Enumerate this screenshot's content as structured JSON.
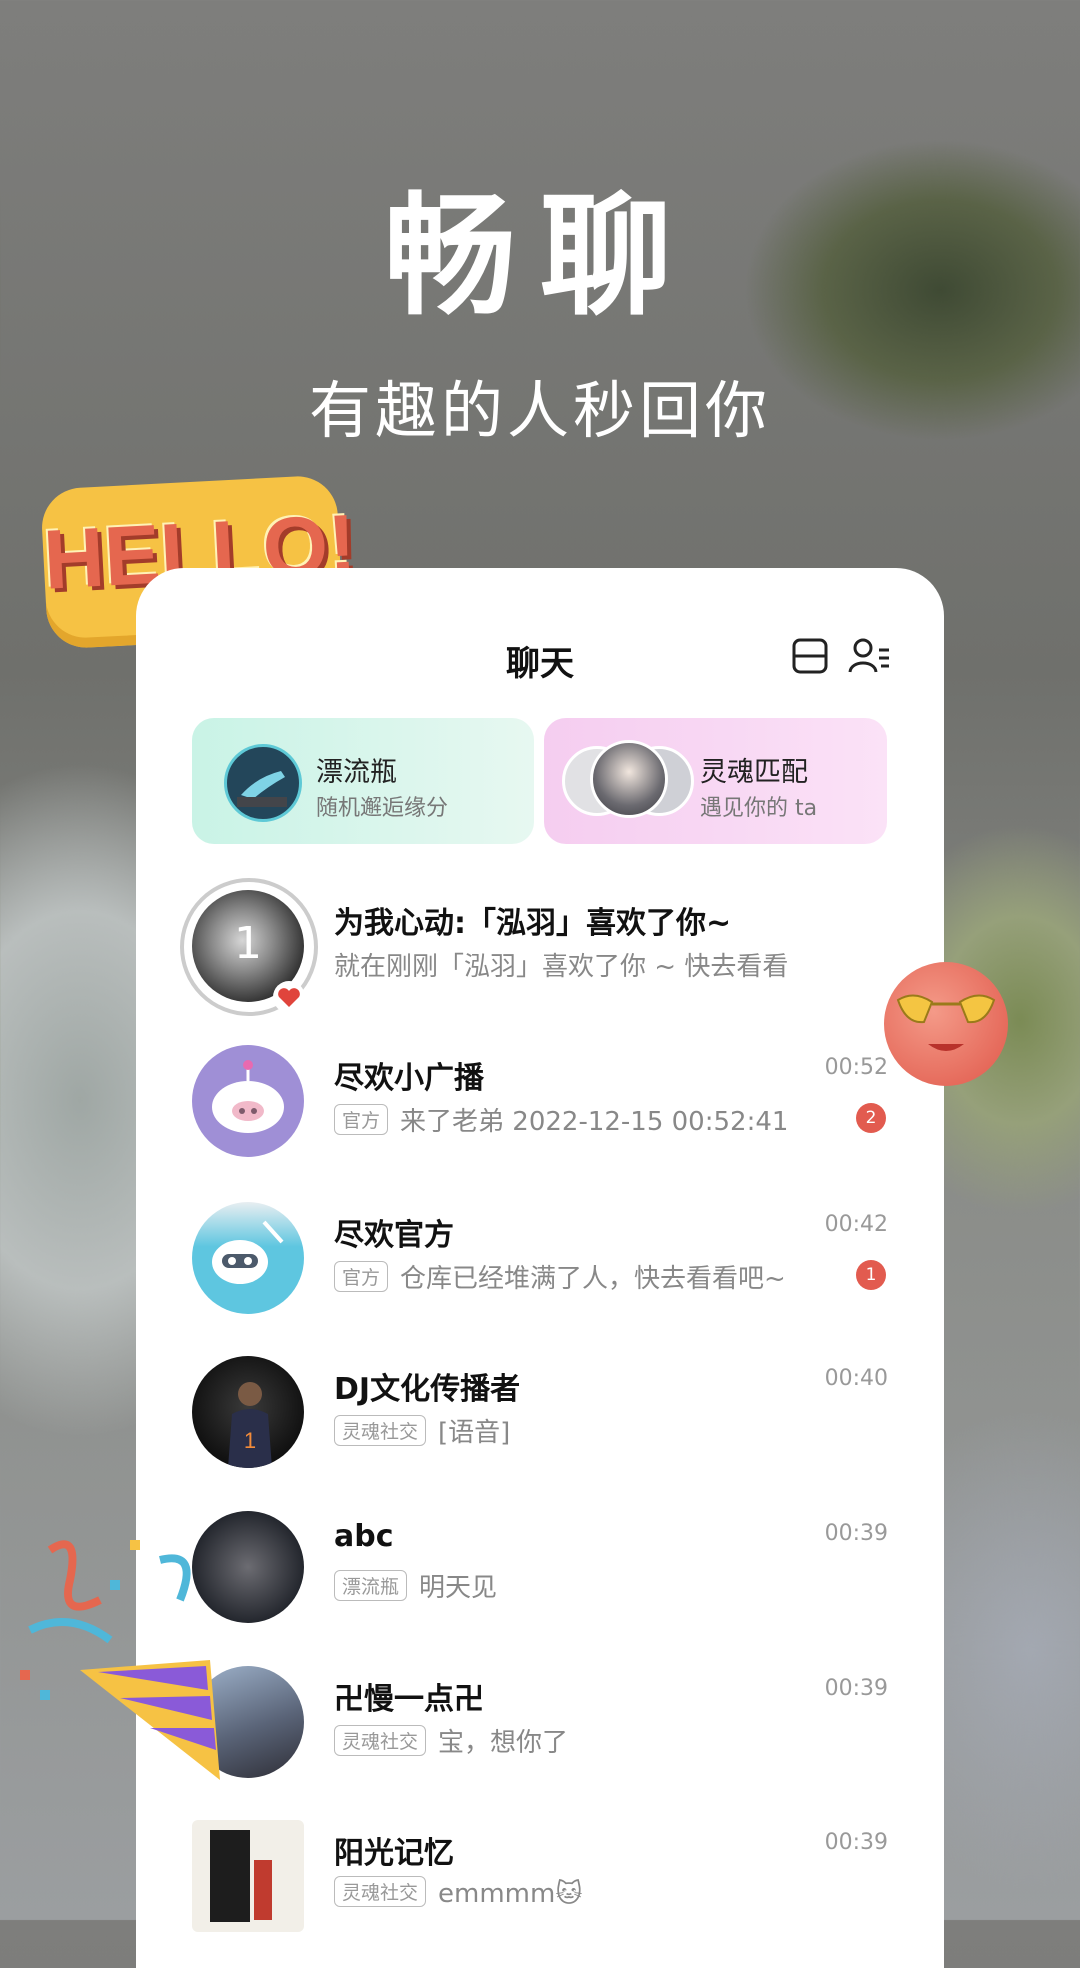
{
  "promo": {
    "title": "畅聊",
    "subtitle": "有趣的人秒回你",
    "hello_sticker": "HELLO!"
  },
  "header": {
    "title": "聊天",
    "icons": [
      "scan-icon",
      "contacts-menu-icon"
    ]
  },
  "features": [
    {
      "title": "漂流瓶",
      "subtitle": "随机邂逅缘分",
      "icon": "drift-bottle-icon"
    },
    {
      "title": "灵魂匹配",
      "subtitle": "遇见你的 ta",
      "icon": "soul-match-avatars"
    }
  ],
  "heart_notice": {
    "title": "为我心动:「泓羽」喜欢了你~",
    "preview": "就在刚刚「泓羽」喜欢了你 ~ 快去看看",
    "avatar_count": "1"
  },
  "chats": [
    {
      "name": "尽欢小广播",
      "tag": "官方",
      "preview": "来了老弟 2022-12-15 00:52:41",
      "time": "00:52",
      "unread": "2",
      "avatar_color": "#9f8fd6"
    },
    {
      "name": "尽欢官方",
      "tag": "官方",
      "preview": "仓库已经堆满了人，快去看看吧~",
      "time": "00:42",
      "unread": "1",
      "avatar_color": "#5ec6e0"
    },
    {
      "name": "DJ文化传播者",
      "tag": "灵魂社交",
      "preview": "[语音]",
      "time": "00:40",
      "unread": "",
      "avatar_color": "#1b1b1b"
    },
    {
      "name": "abc",
      "tag": "漂流瓶",
      "preview": "明天见",
      "time": "00:39",
      "unread": "",
      "avatar_color": "#2b2f3a"
    },
    {
      "name": "卍慢一点卍",
      "tag": "灵魂社交",
      "preview": "宝，想你了",
      "time": "00:39",
      "unread": "",
      "avatar_color": "#6e7a8e"
    },
    {
      "name": "阳光记忆",
      "tag": "灵魂社交",
      "preview": "emmmm🐱",
      "time": "00:39",
      "unread": "",
      "avatar_color": "#f2efe8"
    }
  ],
  "colors": {
    "unread_badge": "#e25b4f",
    "bottle_card": "#c9f3e6",
    "soul_card": "#f5cdf0"
  }
}
